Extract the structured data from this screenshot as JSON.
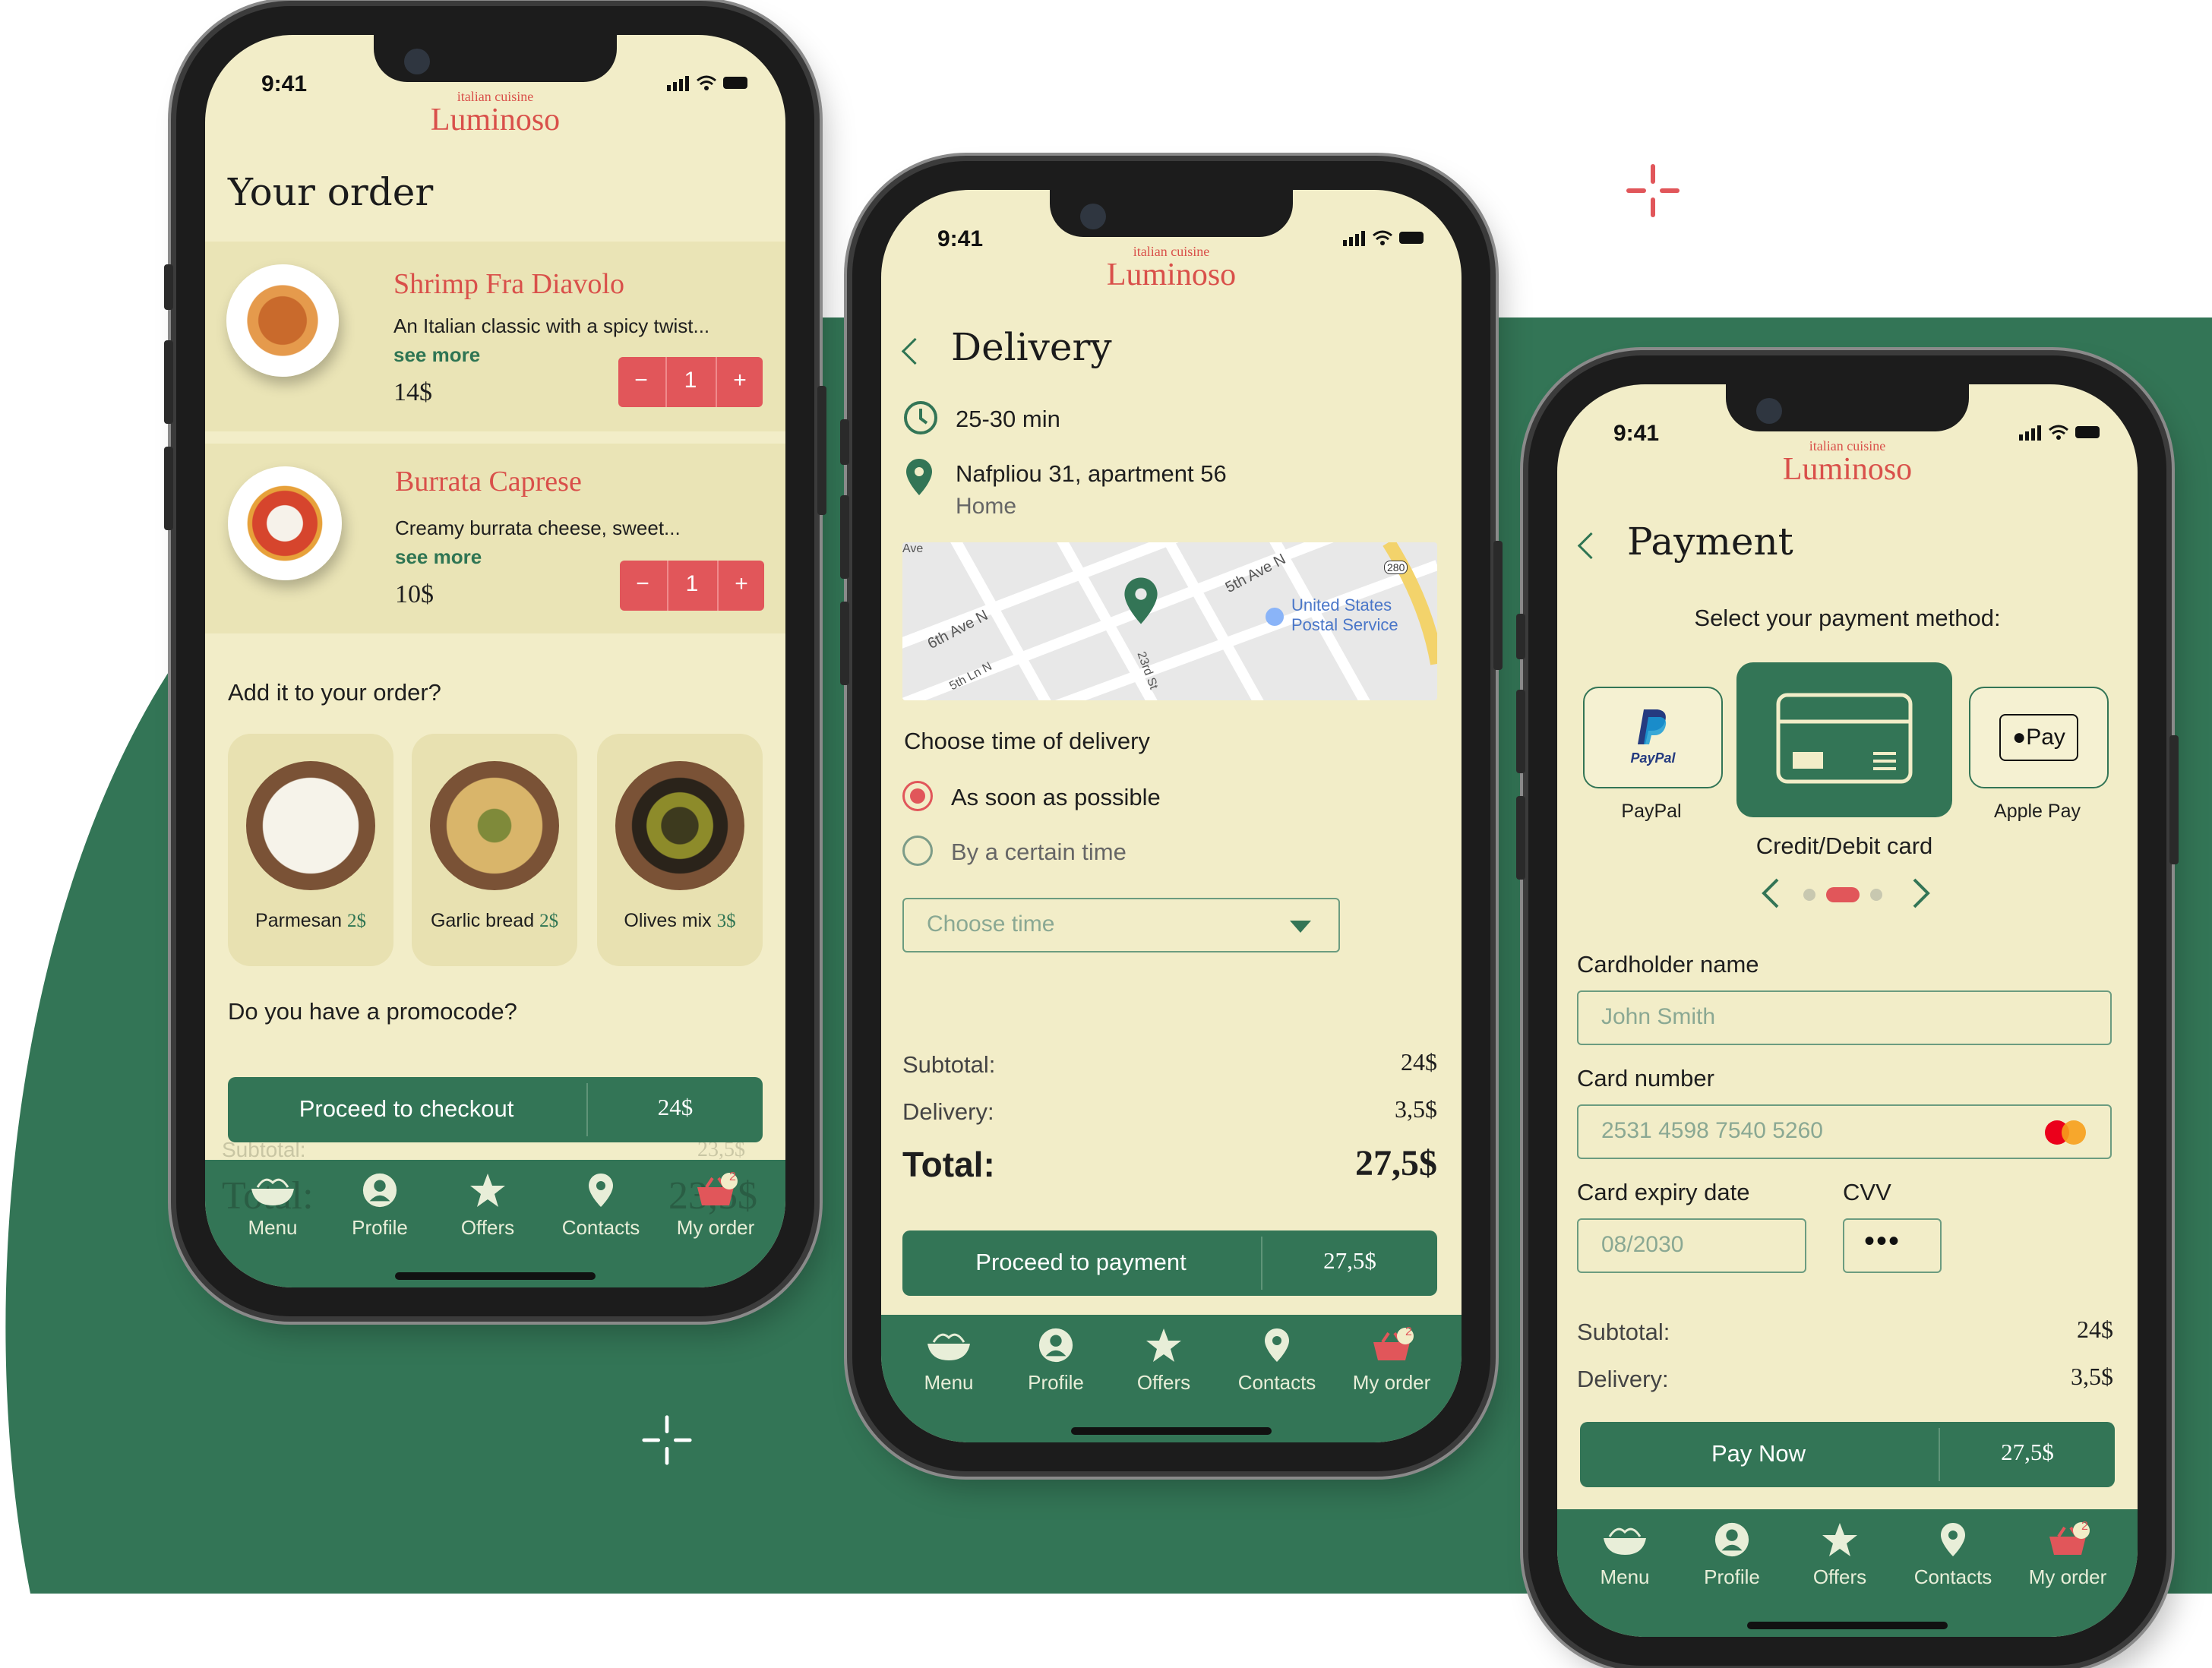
{
  "colors": {
    "brand_green": "#337556",
    "accent_red": "#e1565a",
    "cream": "#f2edc8"
  },
  "status": {
    "time": "9:41"
  },
  "brand": {
    "subtitle": "italian cuisine",
    "name": "Luminoso"
  },
  "tabs": [
    {
      "label": "Menu",
      "icon": "noodle-bowl-icon"
    },
    {
      "label": "Profile",
      "icon": "profile-icon"
    },
    {
      "label": "Offers",
      "icon": "star-icon"
    },
    {
      "label": "Contacts",
      "icon": "location-pin-icon"
    },
    {
      "label": "My order",
      "icon": "basket-icon",
      "badge": "2"
    }
  ],
  "order": {
    "title": "Your order",
    "items": [
      {
        "name": "Shrimp Fra Diavolo",
        "desc": "An Italian classic with a spicy twist...",
        "see_more": "see more",
        "price": "14$",
        "qty": "1",
        "minus": "−",
        "plus": "+"
      },
      {
        "name": "Burrata Caprese",
        "desc": "Creamy burrata cheese, sweet...",
        "see_more": "see more",
        "price": "10$",
        "qty": "1",
        "minus": "−",
        "plus": "+"
      }
    ],
    "add_title": "Add it to your order?",
    "addons": [
      {
        "name": "Parmesan",
        "price": "2$"
      },
      {
        "name": "Garlic bread",
        "price": "2$"
      },
      {
        "name": "Olives mix",
        "price": "3$"
      }
    ],
    "promo_question": "Do you have a promocode?",
    "checkout_label": "Proceed to checkout",
    "checkout_amount": "24$",
    "ghost_subtotal_label": "Subtotal:",
    "ghost_subtotal_value": "23,5$",
    "ghost_total_label": "Total:",
    "ghost_total_value": "23,5$"
  },
  "delivery": {
    "title": "Delivery",
    "eta": "25-30 min",
    "address": "Nafpliou 31, apartment 56",
    "address_label": "Home",
    "map_labels": [
      "5th Ave N",
      "6th Ave N",
      "5th Ln N",
      "23rd St",
      "United States",
      "Postal Service",
      "280",
      "Ave"
    ],
    "choose_time_title": "Choose time of delivery",
    "option_asap": "As soon as possible",
    "option_certain": "By a certain time",
    "select_placeholder": "Choose time",
    "subtotal_label": "Subtotal:",
    "subtotal_value": "24$",
    "delivery_label": "Delivery:",
    "delivery_value": "3,5$",
    "total_label": "Total:",
    "total_value": "27,5$",
    "button_label": "Proceed to payment",
    "button_amount": "27,5$"
  },
  "payment": {
    "title": "Payment",
    "select_prompt": "Select your payment method:",
    "methods": [
      {
        "label": "PayPal",
        "icon": "paypal-icon",
        "logo_text": "PayPal"
      },
      {
        "label": "Credit/Debit card",
        "icon": "credit-card-icon",
        "selected": true
      },
      {
        "label": "Apple Pay",
        "icon": "apple-pay-icon",
        "logo_text": "Pay"
      }
    ],
    "cardholder_label": "Cardholder name",
    "cardholder_value": "John Smith",
    "card_number_label": "Card number",
    "card_number_value": "2531  4598  7540  5260",
    "expiry_label": "Card expiry date",
    "expiry_value": "08/2030",
    "cvv_label": "CVV",
    "cvv_value": "•••",
    "subtotal_label": "Subtotal:",
    "subtotal_value": "24$",
    "delivery_label": "Delivery:",
    "delivery_value": "3,5$",
    "button_label": "Pay Now",
    "button_amount": "27,5$"
  }
}
